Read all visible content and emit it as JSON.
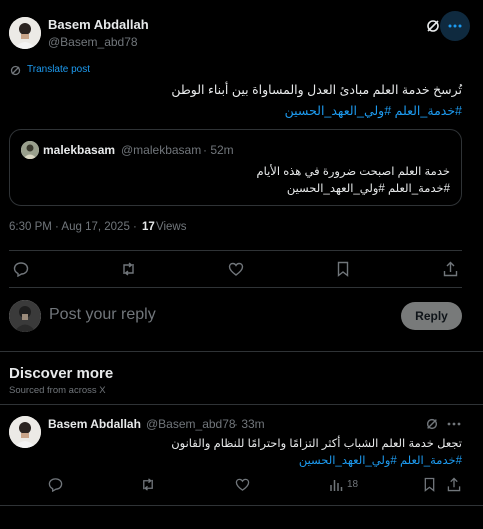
{
  "main_post": {
    "author_name": "Basem Abdallah",
    "author_handle": "@Basem_abd78",
    "translate_label": "Translate post",
    "text_line1": "تُرسخ خدمة العلم مبادئ العدل والمساواة بين أبناء الوطن",
    "hashtags": "#خدمة_العلم #ولي_العهد_الحسين",
    "quote": {
      "author_name": "malekbasam",
      "author_handle": "@malekbasam",
      "time": "· 52m",
      "text_line1": "خدمة العلم اصبحت ضرورة في هذه الأيام",
      "hashtags": "#خدمة_العلم #ولي_العهد_الحسين"
    },
    "timestamp": "6:30 PM · Aug 17, 2025 ·",
    "views_count": "17",
    "views_label": "Views"
  },
  "reply": {
    "placeholder": "Post your reply",
    "button_label": "Reply"
  },
  "discover": {
    "title": "Discover more",
    "subtitle": "Sourced from across X"
  },
  "discover_post": {
    "author_name": "Basem Abdallah",
    "author_handle": "@Basem_abd78",
    "time": "· 33m",
    "text_line1": "تجعل خدمة العلم الشباب أكثر التزامًا واحترامًا للنظام والقانون",
    "hashtags": "#خدمة_العلم #ولي_العهد_الحسين",
    "views_count": "18"
  },
  "colors": {
    "accent": "#1d9bf0",
    "muted": "#71767b",
    "background": "#000000"
  }
}
